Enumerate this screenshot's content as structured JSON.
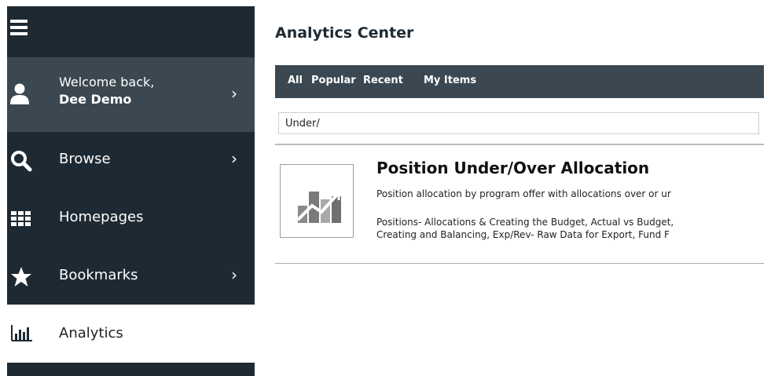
{
  "sidebar": {
    "user": {
      "greeting": "Welcome back,",
      "name": "Dee Demo"
    },
    "nav": [
      {
        "label": "Browse",
        "icon": "search-icon"
      },
      {
        "label": "Homepages",
        "icon": "grid-icon"
      },
      {
        "label": "Bookmarks",
        "icon": "star-icon"
      }
    ],
    "active": {
      "label": "Analytics",
      "icon": "bar-chart-icon"
    },
    "chevron": "›"
  },
  "main": {
    "title": "Analytics Center",
    "tabs": [
      "All",
      "Popular",
      "Recent",
      "My Items"
    ],
    "search": {
      "value": "Under/"
    },
    "result": {
      "title": "Position Under/Over Allocation",
      "description": "Position allocation by program offer with allocations over or ur",
      "tags_line1": "Positions- Allocations & Creating the Budget, Actual vs Budget,",
      "tags_line2": "Creating and Balancing, Exp/Rev- Raw Data for Export, Fund F"
    }
  },
  "colors": {
    "sidebar_dark": "#1e2a33",
    "sidebar_mid": "#3b4852",
    "tab_bar": "#3b4852"
  }
}
